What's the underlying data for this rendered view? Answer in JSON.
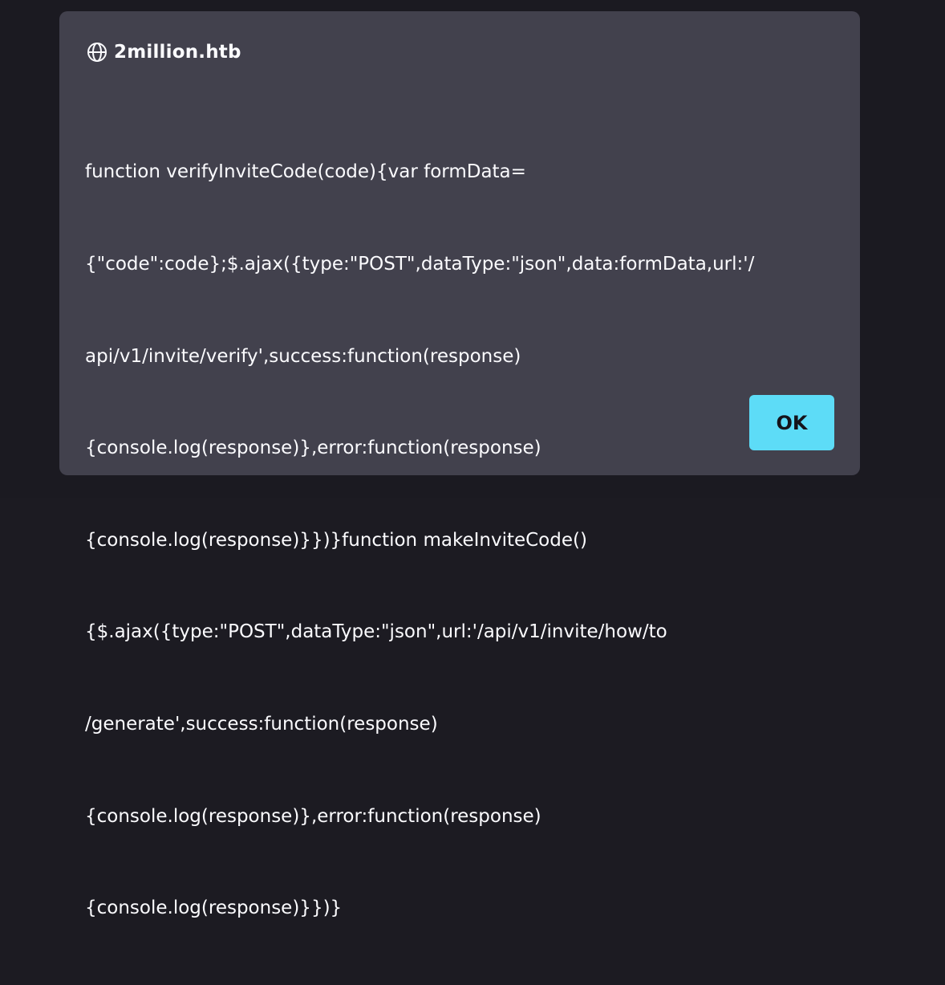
{
  "dialog": {
    "origin": "2million.htb",
    "origin_icon": "globe-icon",
    "message_lines": [
      "function verifyInviteCode(code){var formData=",
      "{\"code\":code};$.ajax({type:\"POST\",dataType:\"json\",data:formData,url:'/",
      "api/v1/invite/verify',success:function(response)",
      "{console.log(response)},error:function(response)",
      "{console.log(response)}})}function makeInviteCode()",
      "{$.ajax({type:\"POST\",dataType:\"json\",url:'/api/v1/invite/how/to",
      "/generate',success:function(response)",
      "{console.log(response)},error:function(response)",
      "{console.log(response)}})}"
    ],
    "ok_label": "OK"
  },
  "colors": {
    "dialog_bg": "#42414d",
    "text": "#fbfbfe",
    "button_bg": "#5ddcf7",
    "button_text": "#15141a",
    "backdrop": "#1b1a21"
  }
}
